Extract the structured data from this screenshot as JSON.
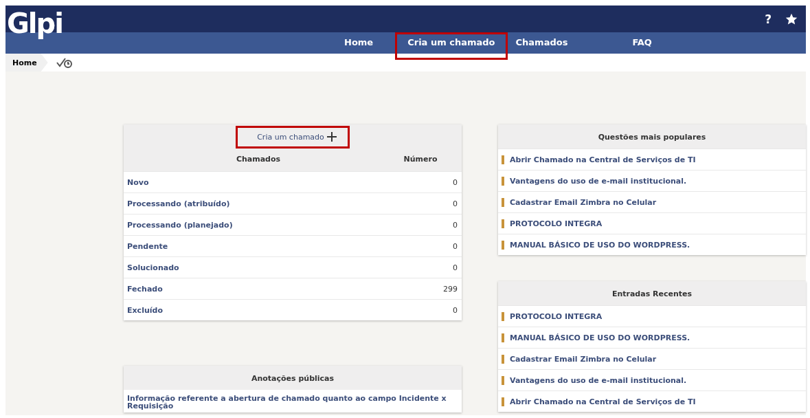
{
  "header": {
    "logo": "Glpi",
    "nav": [
      {
        "label": "Home",
        "highlighted": false
      },
      {
        "label": "Cria um chamado",
        "highlighted": true
      },
      {
        "label": "Chamados",
        "highlighted": false
      },
      {
        "label": "FAQ",
        "highlighted": false
      }
    ],
    "help": "?"
  },
  "breadcrumb": {
    "label": "Home"
  },
  "tickets_panel": {
    "create_link": {
      "label": "Cria um chamado",
      "highlighted": true
    },
    "columns": [
      "Chamados",
      "Número"
    ],
    "rows": [
      {
        "status": "Novo",
        "count": "0"
      },
      {
        "status": "Processando (atribuído)",
        "count": "0"
      },
      {
        "status": "Processando (planejado)",
        "count": "0"
      },
      {
        "status": "Pendente",
        "count": "0"
      },
      {
        "status": "Solucionado",
        "count": "0"
      },
      {
        "status": "Fechado",
        "count": "299"
      },
      {
        "status": "Excluído",
        "count": "0"
      }
    ]
  },
  "notes_panel": {
    "title": "Anotações públicas",
    "items": [
      "Informação referente a abertura de chamado quanto ao campo Incidente x Requisição"
    ]
  },
  "popular_panel": {
    "title": "Questões mais populares",
    "items": [
      "Abrir Chamado na Central de Serviços de TI",
      "Vantagens do uso de e-mail institucional.",
      "Cadastrar Email Zimbra no Celular",
      "PROTOCOLO INTEGRA",
      "MANUAL BÁSICO DE USO DO WORDPRESS."
    ]
  },
  "recent_panel": {
    "title": "Entradas Recentes",
    "items": [
      "PROTOCOLO INTEGRA",
      "MANUAL BÁSICO DE USO DO WORDPRESS.",
      "Cadastrar Email Zimbra no Celular",
      "Vantagens do uso de e-mail institucional.",
      "Abrir Chamado na Central de Serviços de TI"
    ]
  }
}
